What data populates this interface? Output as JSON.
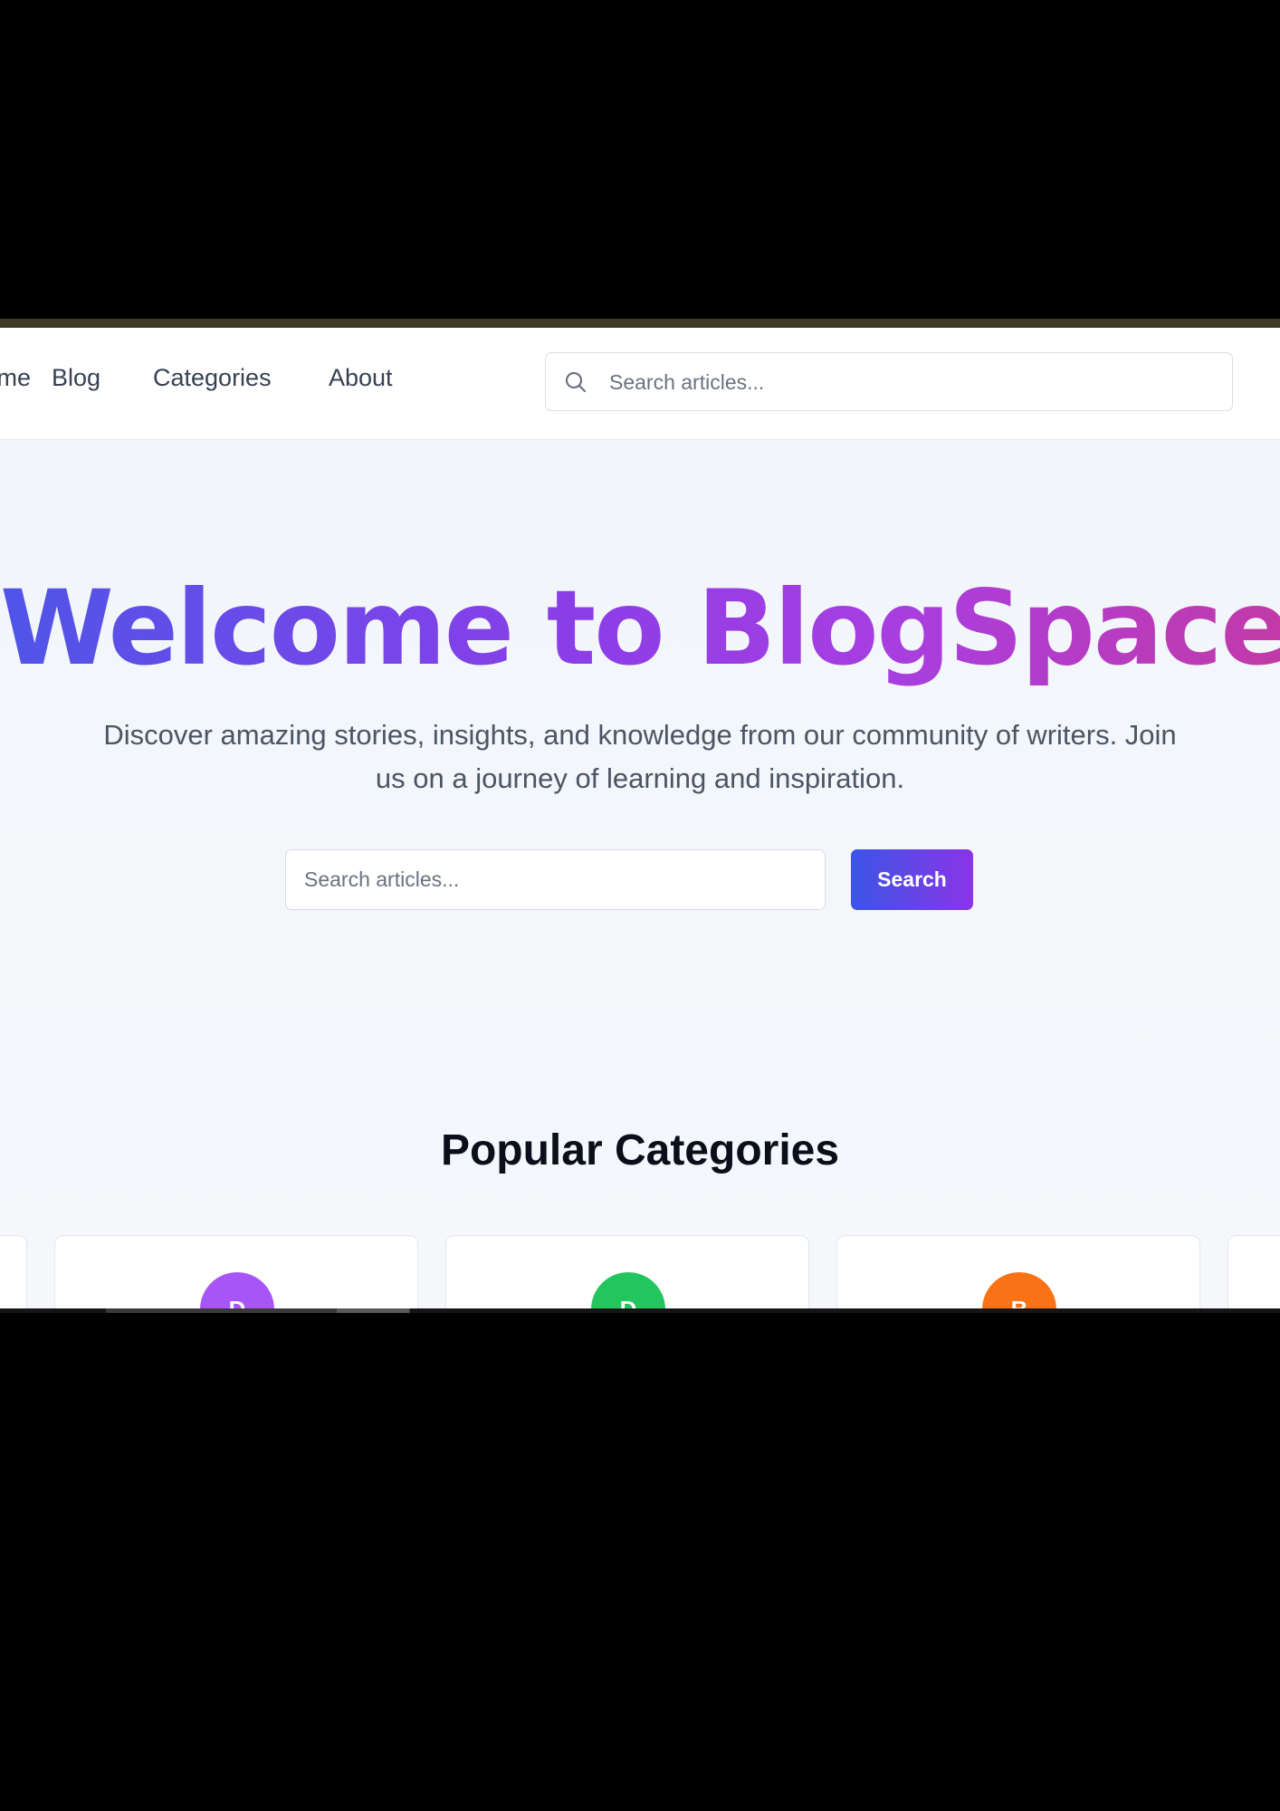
{
  "nav": {
    "items": [
      {
        "label": "Home",
        "visible_text": "e"
      },
      {
        "label": "Blog"
      },
      {
        "label": "Categories"
      },
      {
        "label": "About"
      }
    ],
    "search": {
      "placeholder": "Search articles..."
    }
  },
  "hero": {
    "title": "Welcome to BlogSpace",
    "subtitle": "Discover amazing stories, insights, and knowledge from our community of writers. Join us on a journey of learning and inspiration.",
    "search_placeholder": "Search articles...",
    "search_button": "Search"
  },
  "categories": {
    "title": "Popular Categories",
    "cards": [
      {
        "initial": "D",
        "color": "#a855f7"
      },
      {
        "initial": "D",
        "color": "#22c55e"
      },
      {
        "initial": "B",
        "color": "#f97316"
      }
    ]
  },
  "colors": {
    "accent_start": "#3b55e6",
    "accent_end": "#8a35e6",
    "title_gradient_start": "#4f55e8",
    "title_gradient_end": "#c23aa8"
  }
}
